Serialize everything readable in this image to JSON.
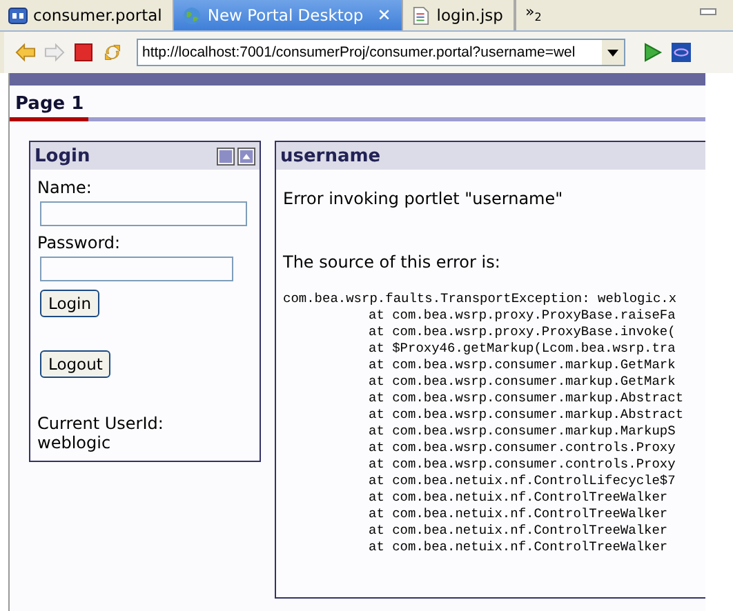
{
  "editor_tabs": [
    {
      "label": "consumer.portal",
      "selected": false
    },
    {
      "label": "New Portal Desktop",
      "selected": true,
      "close": "✕"
    },
    {
      "label": "login.jsp",
      "selected": false
    }
  ],
  "overflow": {
    "symbol": "»",
    "count": "2"
  },
  "address_bar": {
    "url": "http://localhost:7001/consumerProj/consumer.portal?username=wel"
  },
  "page_tabs": [
    {
      "label": "Page 1",
      "selected": true
    }
  ],
  "login_portlet": {
    "title": "Login",
    "fields": [
      {
        "label": "Name:"
      },
      {
        "label": "Password:"
      }
    ],
    "buttons": [
      "Login",
      "Logout"
    ],
    "user_label": "Current UserId:",
    "user_value": "weblogic"
  },
  "error_portlet": {
    "title": "username",
    "message": "Error invoking portlet \"username\"",
    "source_label": "The source of this error is:",
    "trace": [
      {
        "kind": "head",
        "text": "com.bea.wsrp.faults.TransportException: weblogic.x"
      },
      {
        "kind": "frame",
        "text": "at com.bea.wsrp.proxy.ProxyBase.raiseFa"
      },
      {
        "kind": "frame",
        "text": "at com.bea.wsrp.proxy.ProxyBase.invoke("
      },
      {
        "kind": "frame",
        "text": "at $Proxy46.getMarkup(Lcom.bea.wsrp.tra"
      },
      {
        "kind": "frame",
        "text": "at com.bea.wsrp.consumer.markup.GetMark"
      },
      {
        "kind": "frame",
        "text": "at com.bea.wsrp.consumer.markup.GetMark"
      },
      {
        "kind": "frame",
        "text": "at com.bea.wsrp.consumer.markup.Abstract"
      },
      {
        "kind": "frame",
        "text": "at com.bea.wsrp.consumer.markup.Abstract"
      },
      {
        "kind": "frame",
        "text": "at com.bea.wsrp.consumer.markup.MarkupS"
      },
      {
        "kind": "frame",
        "text": "at com.bea.wsrp.consumer.controls.Proxy"
      },
      {
        "kind": "frame",
        "text": "at com.bea.wsrp.consumer.controls.Proxy"
      },
      {
        "kind": "frame",
        "text": "at com.bea.netuix.nf.ControlLifecycle$7"
      },
      {
        "kind": "frame",
        "text": "at com.bea.netuix.nf.ControlTreeWalker"
      },
      {
        "kind": "frame",
        "text": "at com.bea.netuix.nf.ControlTreeWalker"
      },
      {
        "kind": "frame",
        "text": "at com.bea.netuix.nf.ControlTreeWalker"
      },
      {
        "kind": "frame",
        "text": "at com.bea.netuix.nf.ControlTreeWalker"
      }
    ]
  }
}
